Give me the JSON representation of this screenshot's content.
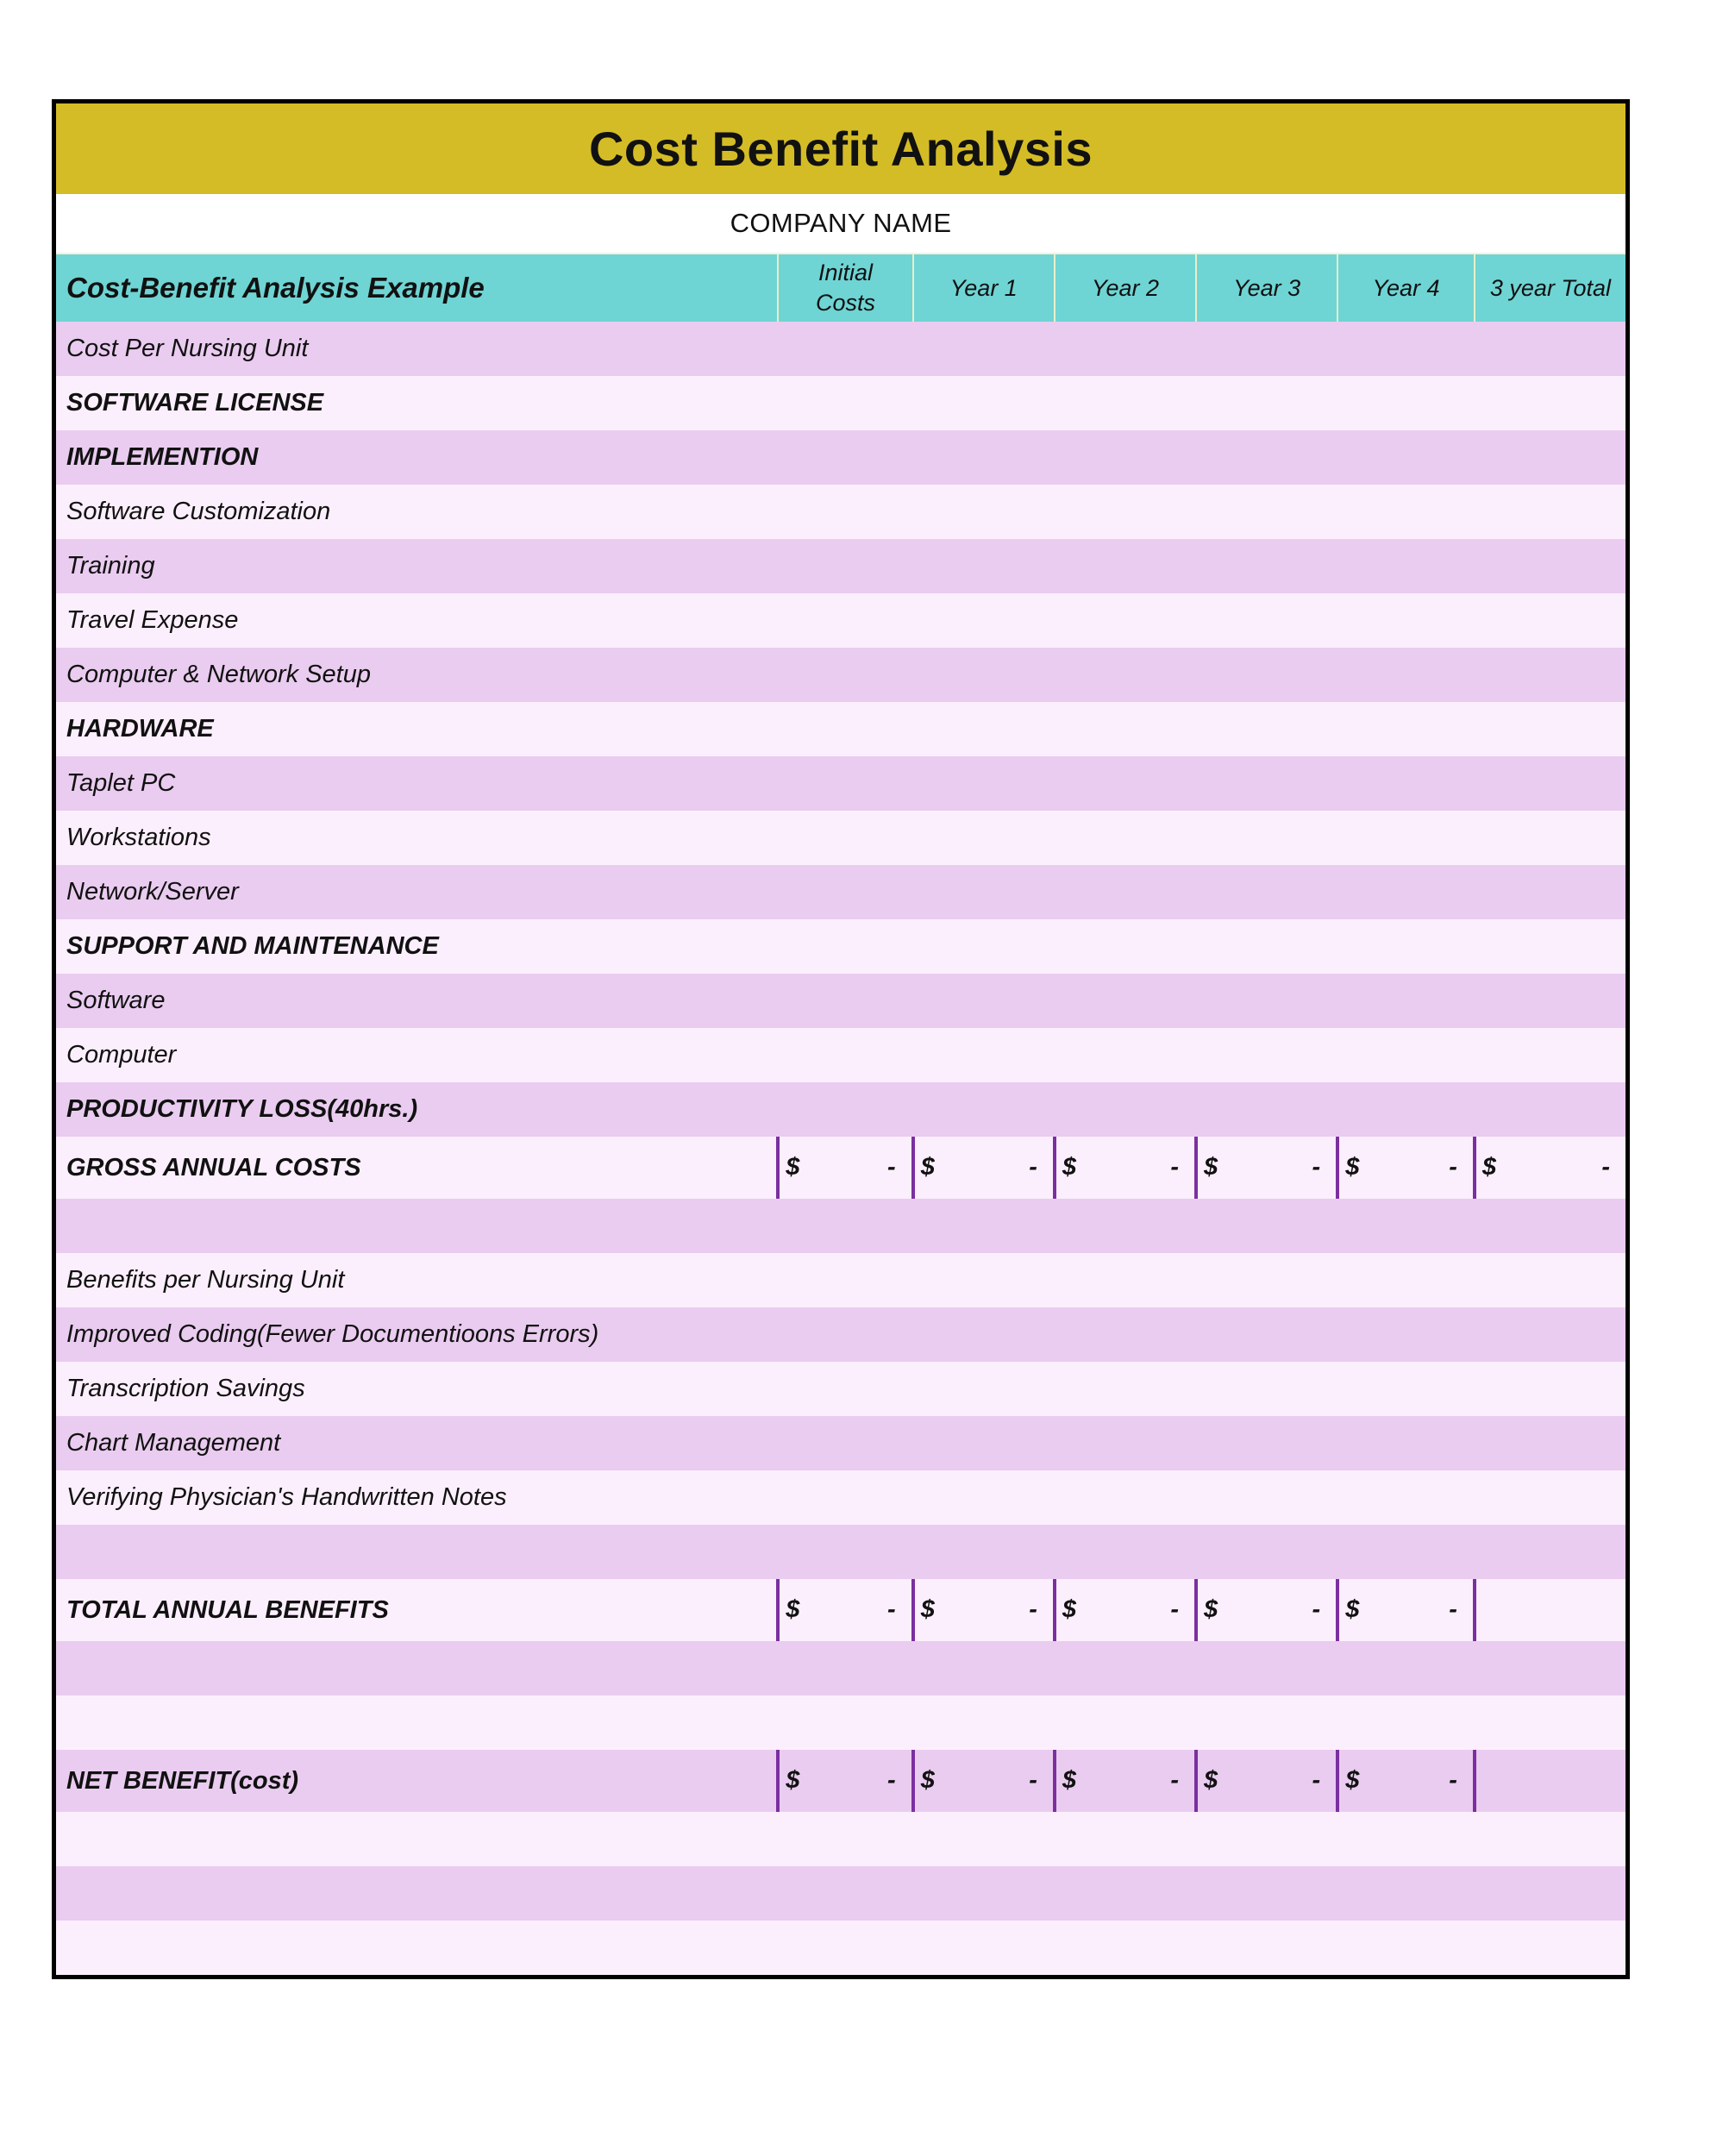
{
  "document": {
    "title": "Cost Benefit Analysis",
    "company_name": "COMPANY NAME"
  },
  "colors": {
    "title_band": "#d4bc26",
    "table_header": "#6fd4d4",
    "row_dark": "#eaccf0",
    "row_light": "#fceffd",
    "money_divider": "#7b2fa0",
    "page_border": "#000000"
  },
  "table": {
    "header": {
      "label": "Cost-Benefit Analysis Example",
      "columns": [
        {
          "line1": "Initial",
          "line2": "Costs"
        },
        {
          "line1": "Year 1",
          "line2": ""
        },
        {
          "line1": "Year 2",
          "line2": ""
        },
        {
          "line1": "Year 3",
          "line2": ""
        },
        {
          "line1": "Year 4",
          "line2": ""
        },
        {
          "line1": "3 year Total",
          "line2": ""
        }
      ]
    },
    "currency_symbol": "$",
    "empty_value": "-",
    "rows": [
      {
        "label": "Cost Per Nursing Unit",
        "style": "plain",
        "shade": "dark",
        "money": []
      },
      {
        "label": "SOFTWARE LICENSE",
        "style": "bold",
        "shade": "light",
        "money": []
      },
      {
        "label": "IMPLEMENTION",
        "style": "bold",
        "shade": "dark",
        "money": []
      },
      {
        "label": "Software Customization",
        "style": "indent",
        "shade": "light",
        "money": []
      },
      {
        "label": "Training",
        "style": "indent",
        "shade": "dark",
        "money": []
      },
      {
        "label": "Travel Expense",
        "style": "indent",
        "shade": "light",
        "money": []
      },
      {
        "label": "Computer & Network Setup",
        "style": "indent",
        "shade": "dark",
        "money": []
      },
      {
        "label": "HARDWARE",
        "style": "bold",
        "shade": "light",
        "money": []
      },
      {
        "label": "Taplet PC",
        "style": "indent",
        "shade": "dark",
        "money": []
      },
      {
        "label": "Workstations",
        "style": "indent",
        "shade": "light",
        "money": []
      },
      {
        "label": "Network/Server",
        "style": "indent",
        "shade": "dark",
        "money": []
      },
      {
        "label": "SUPPORT AND MAINTENANCE",
        "style": "bold",
        "shade": "light",
        "money": []
      },
      {
        "label": "Software",
        "style": "indent",
        "shade": "dark",
        "money": []
      },
      {
        "label": "Computer",
        "style": "indent",
        "shade": "light",
        "money": []
      },
      {
        "label": "PRODUCTIVITY LOSS(40hrs.)",
        "style": "bold",
        "shade": "dark",
        "money": []
      },
      {
        "label": "GROSS ANNUAL COSTS",
        "style": "bold",
        "shade": "light",
        "money": [
          "-",
          "-",
          "-",
          "-",
          "-",
          "-"
        ]
      },
      {
        "label": "",
        "style": "plain",
        "shade": "dark",
        "money": []
      },
      {
        "label": "Benefits per Nursing Unit",
        "style": "plain",
        "shade": "light",
        "money": []
      },
      {
        "label": "Improved Coding(Fewer Documentioons Errors)",
        "style": "plain",
        "shade": "dark",
        "money": []
      },
      {
        "label": "Transcription Savings",
        "style": "plain",
        "shade": "light",
        "money": []
      },
      {
        "label": "Chart Management",
        "style": "plain",
        "shade": "dark",
        "money": []
      },
      {
        "label": "Verifying Physician's Handwritten Notes",
        "style": "plain",
        "shade": "light",
        "money": []
      },
      {
        "label": "",
        "style": "plain",
        "shade": "dark",
        "money": []
      },
      {
        "label": "TOTAL ANNUAL BENEFITS",
        "style": "bold",
        "shade": "light",
        "money": [
          "-",
          "-",
          "-",
          "-",
          "-",
          ""
        ]
      },
      {
        "label": "",
        "style": "plain",
        "shade": "dark",
        "money": []
      },
      {
        "label": "",
        "style": "plain",
        "shade": "light",
        "money": []
      },
      {
        "label": "NET BENEFIT(cost)",
        "style": "bold",
        "shade": "dark",
        "money": [
          "-",
          "-",
          "-",
          "-",
          "-",
          ""
        ]
      },
      {
        "label": "",
        "style": "plain",
        "shade": "light",
        "money": []
      },
      {
        "label": "",
        "style": "plain",
        "shade": "dark",
        "money": []
      },
      {
        "label": "",
        "style": "plain",
        "shade": "light",
        "money": []
      }
    ]
  }
}
